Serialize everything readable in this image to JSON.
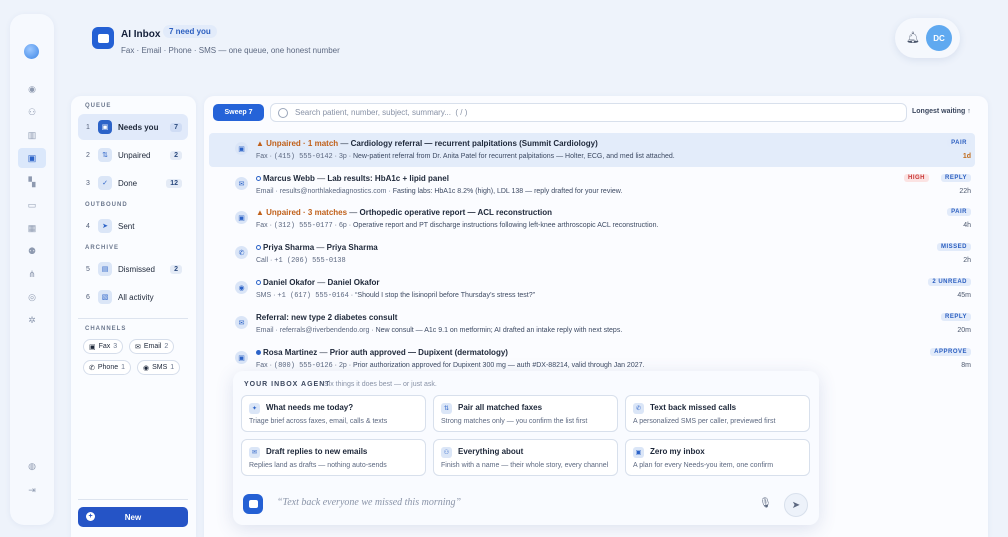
{
  "app": {
    "title": "AI Inbox",
    "need_badge": "7 need you",
    "subtitle": "Fax · Email · Phone · SMS — one queue, one honest number",
    "avatar": "DC"
  },
  "sidebar": {
    "queue_label": "QUEUE",
    "queue": [
      {
        "num": "1",
        "label": "Needs you",
        "count": "7"
      },
      {
        "num": "2",
        "label": "Unpaired",
        "count": "2"
      },
      {
        "num": "3",
        "label": "Done",
        "count": "12"
      }
    ],
    "outbound_label": "OUTBOUND",
    "outbound": [
      {
        "num": "4",
        "label": "Sent"
      }
    ],
    "archive_label": "ARCHIVE",
    "archive": [
      {
        "num": "5",
        "label": "Dismissed",
        "count": "2"
      },
      {
        "num": "6",
        "label": "All activity"
      }
    ],
    "channels_label": "CHANNELS",
    "channels": [
      {
        "label": "Fax",
        "count": "3"
      },
      {
        "label": "Email",
        "count": "2"
      },
      {
        "label": "Phone",
        "count": "1"
      },
      {
        "label": "SMS",
        "count": "1"
      }
    ],
    "new_label": "New"
  },
  "toolbar": {
    "sweep": "Sweep 7",
    "search_placeholder": "Search patient, number, subject, summary...  ( / )",
    "sort": "Longest waiting ↑"
  },
  "rows": [
    {
      "warn": "Unpaired · 1 match",
      "sep": "—",
      "subject": "Cardiology referral — recurrent palpitations (Summit Cardiology)",
      "channel": "Fax",
      "contact": "(415) 555-0142",
      "pages": "3p",
      "snippet": "New-patient referral from Dr. Anita Patel for recurrent palpitations — Holter, ECG, and med list attached.",
      "tag": "PAIR",
      "age": "1d"
    },
    {
      "name": "Marcus Webb",
      "sep": "—",
      "subject": "Lab results: HbA1c + lipid panel",
      "channel": "Email",
      "contact": "results@northlakediagnostics.com",
      "snippet": "Fasting labs: HbA1c 8.2% (high), LDL 138 — reply drafted for your review.",
      "tag": "REPLY",
      "tag2": "HIGH",
      "age": "22h"
    },
    {
      "warn": "Unpaired · 3 matches",
      "sep": "—",
      "subject": "Orthopedic operative report — ACL reconstruction",
      "channel": "Fax",
      "contact": "(312) 555-0177",
      "pages": "6p",
      "snippet": "Operative report and PT discharge instructions following left-knee arthroscopic ACL reconstruction.",
      "tag": "PAIR",
      "age": "4h"
    },
    {
      "name": "Priya Sharma",
      "sep": "—",
      "subject": "Priya Sharma",
      "channel": "Call",
      "contact": "+1 (206) 555-0138",
      "tag": "MISSED",
      "age": "2h"
    },
    {
      "name": "Daniel Okafor",
      "sep": "—",
      "subject": "Daniel Okafor",
      "channel": "SMS",
      "contact": "+1 (617) 555-0164",
      "snippet": "“Should I stop the lisinopril before Thursday’s stress test?”",
      "tag": "2 UNREAD",
      "age": "45m"
    },
    {
      "subject": "Referral: new type 2 diabetes consult",
      "channel": "Email",
      "contact": "referrals@riverbendendo.org",
      "snippet": "New consult — A1c 9.1 on metformin; AI drafted an intake reply with next steps.",
      "tag": "REPLY",
      "age": "20m"
    },
    {
      "name": "Rosa Martinez",
      "sep": "—",
      "subject": "Prior auth approved — Dupixent (dermatology)",
      "channel": "Fax",
      "contact": "(800) 555-0126",
      "pages": "2p",
      "snippet": "Prior authorization approved for Dupixent 300 mg — auth #DX-88214, valid through Jan 2027.",
      "tag": "APPROVE",
      "age": "8m"
    }
  ],
  "agent": {
    "heading": "YOUR INBOX AGENT",
    "subheading": "Six things it does best — or just ask.",
    "cards": [
      {
        "title": "What needs me today?",
        "sub": "Triage brief across faxes, email, calls & texts"
      },
      {
        "title": "Pair all matched faxes",
        "sub": "Strong matches only — you confirm the list first"
      },
      {
        "title": "Text back missed calls",
        "sub": "A personalized SMS per caller, previewed first"
      },
      {
        "title": "Draft replies to new emails",
        "sub": "Replies land as drafts — nothing auto-sends"
      },
      {
        "title": "Everything about",
        "sub": "Finish with a name — their whole story, every channel"
      },
      {
        "title": "Zero my inbox",
        "sub": "A plan for every Needs-you item, one confirm"
      }
    ],
    "composer_placeholder": "“Text back everyone we missed this morning”"
  }
}
